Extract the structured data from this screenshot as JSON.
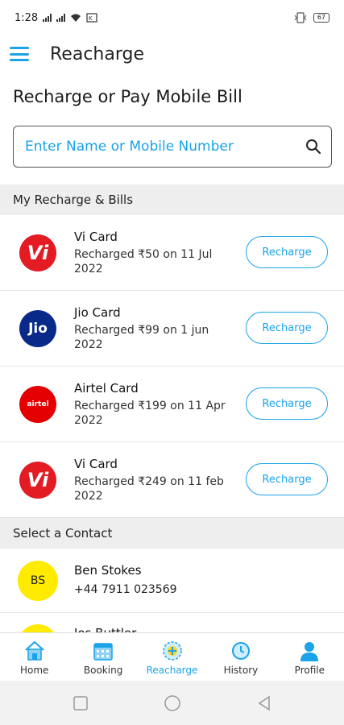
{
  "status_bar": {
    "time": "1:28",
    "battery": "67"
  },
  "app_bar": {
    "title": "Reacharge"
  },
  "heading": "Recharge or Pay Mobile Bill",
  "search": {
    "placeholder": "Enter Name or Mobile Number"
  },
  "sections": {
    "bills": "My Recharge & Bills",
    "contacts": "Select a Contact"
  },
  "bills": [
    {
      "operator": "Vi",
      "logo_text": "Vi",
      "name": "Vi Card",
      "detail": "Recharged ₹50 on 11 Jul 2022",
      "button": "Recharge"
    },
    {
      "operator": "Jio",
      "logo_text": "Jio",
      "name": "Jio Card",
      "detail": "Recharged ₹99 on 1 jun 2022",
      "button": "Recharge"
    },
    {
      "operator": "Airtel",
      "logo_text": "airtel",
      "name": "Airtel Card",
      "detail": "Recharged ₹199 on 11 Apr 2022",
      "button": "Recharge"
    },
    {
      "operator": "Vi",
      "logo_text": "Vi",
      "name": "Vi Card",
      "detail": "Recharged ₹249 on 11 feb 2022",
      "button": "Recharge"
    }
  ],
  "contacts": [
    {
      "initials": "BS",
      "name": "Ben Stokes",
      "phone": "+44 7911 023569"
    },
    {
      "initials": "",
      "name": "Jos Buttler",
      "phone": ""
    }
  ],
  "bottom_nav": [
    {
      "label": "Home",
      "icon": "home-icon",
      "active": false
    },
    {
      "label": "Booking",
      "icon": "calendar-icon",
      "active": false
    },
    {
      "label": "Reacharge",
      "icon": "recharge-icon",
      "active": true
    },
    {
      "label": "History",
      "icon": "history-icon",
      "active": false
    },
    {
      "label": "Profile",
      "icon": "profile-icon",
      "active": false
    }
  ],
  "colors": {
    "accent": "#1aa3e8",
    "vi_red": "#e31b23",
    "jio_blue": "#0a2a8a",
    "airtel_red": "#e40000",
    "avatar_yellow": "#ffeb00"
  }
}
